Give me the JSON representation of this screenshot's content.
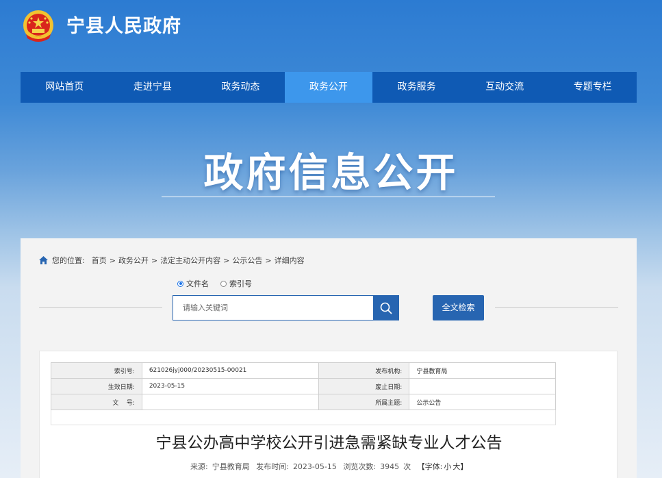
{
  "header": {
    "site_title": "宁县人民政府",
    "emblem_icon": "national-emblem-icon"
  },
  "nav": {
    "items": [
      {
        "label": "网站首页",
        "active": false
      },
      {
        "label": "走进宁县",
        "active": false
      },
      {
        "label": "政务动态",
        "active": false
      },
      {
        "label": "政务公开",
        "active": true
      },
      {
        "label": "政务服务",
        "active": false
      },
      {
        "label": "互动交流",
        "active": false
      },
      {
        "label": "专题专栏",
        "active": false
      }
    ],
    "colors": {
      "bar": "#0f5ab4",
      "active": "#3d97ec"
    }
  },
  "hero": {
    "title": "政府信息公开"
  },
  "breadcrumb": {
    "prefix": "您的位置:",
    "items": [
      "首页",
      "政务公开",
      "法定主动公开内容",
      "公示公告",
      "详细内容"
    ],
    "separator": ">"
  },
  "search": {
    "radio_filename": "文件名",
    "radio_index": "索引号",
    "selected": "文件名",
    "placeholder": "请输入关键词",
    "value": "",
    "fulltext_label": "全文检索",
    "accent": "#2765b1"
  },
  "meta": {
    "index_label": "索引号:",
    "index_value": "621026jyj000/20230515-00021",
    "publisher_label": "发布机构:",
    "publisher_value": "宁县教育局",
    "effective_label": "生效日期:",
    "effective_value": "2023-05-15",
    "repeal_label": "废止日期:",
    "repeal_value": "",
    "docno_label": "文    号:",
    "docno_value": "",
    "topic_label": "所属主题:",
    "topic_value": "公示公告"
  },
  "article": {
    "title": "宁县公办高中学校公开引进急需紧缺专业人才公告",
    "source_label": "来源:",
    "source_value": "宁县教育局",
    "time_label": "发布时间:",
    "time_value": "2023-05-15",
    "views_label": "浏览次数:",
    "views_value": "3945",
    "views_unit": "次",
    "font_label": "【字体:",
    "font_small": "小",
    "font_large": "大",
    "font_close": "】"
  }
}
